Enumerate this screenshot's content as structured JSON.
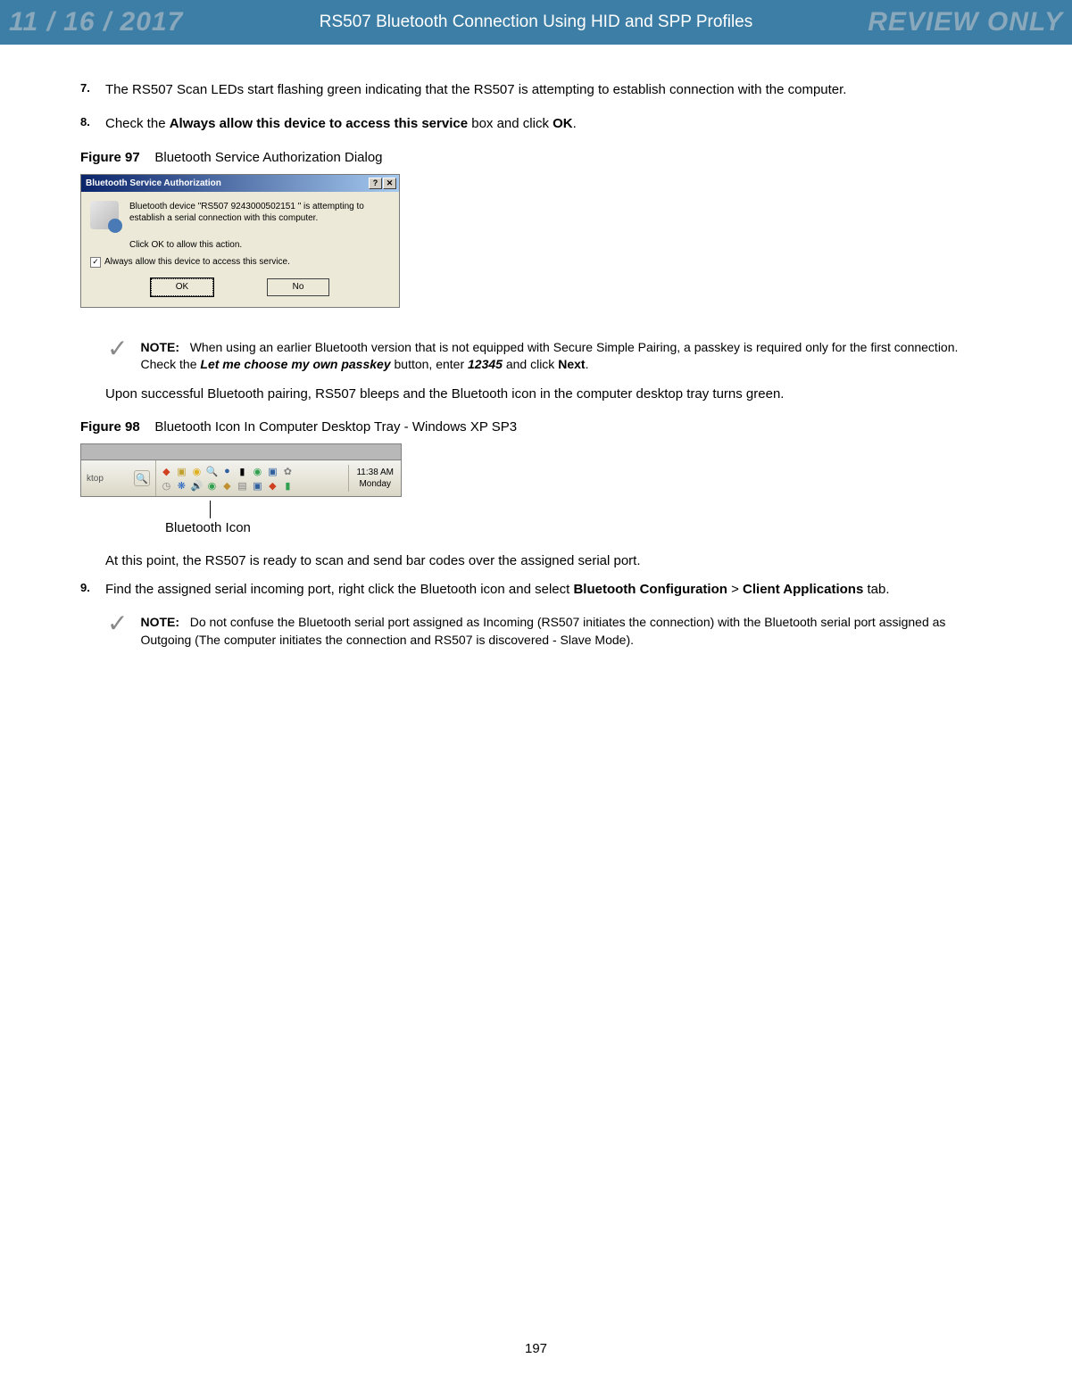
{
  "watermark": {
    "date": "11 / 16 / 2017",
    "review": "REVIEW ONLY"
  },
  "header": {
    "title": "RS507 Bluetooth Connection Using HID and SPP Profiles"
  },
  "steps": {
    "s7": {
      "num": "7.",
      "text": "The RS507 Scan LEDs start flashing green indicating that the RS507 is attempting to establish connection with the computer."
    },
    "s8": {
      "num": "8.",
      "pre": "Check the ",
      "bold1": "Always allow this device to access this service",
      "mid": " box and click ",
      "bold2": "OK",
      "post": "."
    },
    "s9": {
      "num": "9.",
      "pre": "Find the assigned serial incoming port, right click the Bluetooth icon and select ",
      "bold1": "Bluetooth Configuration",
      "mid": " > ",
      "bold2": "Client Applications",
      "post": " tab."
    }
  },
  "figures": {
    "f97": {
      "label": "Figure 97",
      "caption": "Bluetooth Service Authorization Dialog"
    },
    "f98": {
      "label": "Figure 98",
      "caption": "Bluetooth Icon In Computer Desktop Tray - Windows XP SP3"
    }
  },
  "dialog": {
    "title": "Bluetooth Service Authorization",
    "help_btn": "?",
    "close_btn": "✕",
    "line1": "Bluetooth device \"RS507 9243000502151   \" is attempting to establish a serial connection with this computer.",
    "line2": "Click OK to allow this action.",
    "checkmark": "✓",
    "check_label": "Always allow this device to access this service.",
    "ok": "OK",
    "no": "No"
  },
  "notes": {
    "n1": {
      "label": "NOTE:",
      "t1": "When using an earlier Bluetooth version that is not equipped with Secure Simple Pairing, a passkey is required only for the first connection. Check the ",
      "ib1": "Let me choose my own passkey",
      "t2": " button, enter ",
      "ib2": "12345",
      "t3": " and click ",
      "b1": "Next",
      "t4": "."
    },
    "n2": {
      "label": "NOTE:",
      "text": "Do not confuse the Bluetooth serial port assigned as Incoming (RS507 initiates the connection) with the Bluetooth serial port assigned as Outgoing (The computer initiates the connection and RS507 is discovered - Slave Mode)."
    }
  },
  "paragraphs": {
    "p1": "Upon successful Bluetooth pairing, RS507 bleeps and the Bluetooth icon in the computer desktop tray turns green.",
    "p2": "At this point, the RS507 is ready to scan and send bar codes over the assigned serial port."
  },
  "tray": {
    "ktop": "ktop",
    "time": "11:38 AM",
    "day": "Monday",
    "caption": "Bluetooth Icon"
  },
  "page_number": "197"
}
